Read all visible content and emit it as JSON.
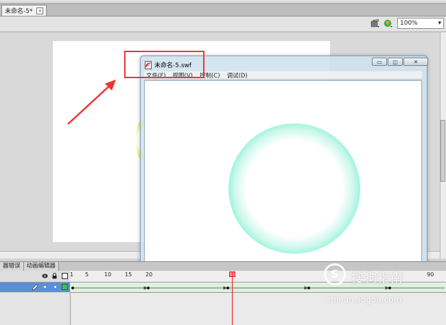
{
  "document": {
    "tab_label": "未命名-5*",
    "close_glyph": "×"
  },
  "edit_bar": {
    "zoom_value": "100%",
    "zoom_arrow": "▾"
  },
  "swf_window": {
    "title": "未命名-5.swf",
    "menu": [
      "文件(F)",
      "视图(V)",
      "控制(C)",
      "调试(D)"
    ],
    "minimize_glyph": "▭",
    "restore_glyph": "◫",
    "close_glyph": "✕"
  },
  "panel_tabs": [
    "器错误",
    "动画编辑器"
  ],
  "timeline": {
    "ruler_ticks": [
      "1",
      "5",
      "10",
      "15",
      "20",
      "90"
    ]
  },
  "watermark": {
    "logo_glyph": "S",
    "text": "搜狗指南",
    "url": "zhinan.sogou.com"
  },
  "colors": {
    "ring_outer": "#1fdfbc",
    "highlight_box": "#e33333",
    "playhead": "#e11111",
    "layer_selected": "#5b8fd6"
  }
}
